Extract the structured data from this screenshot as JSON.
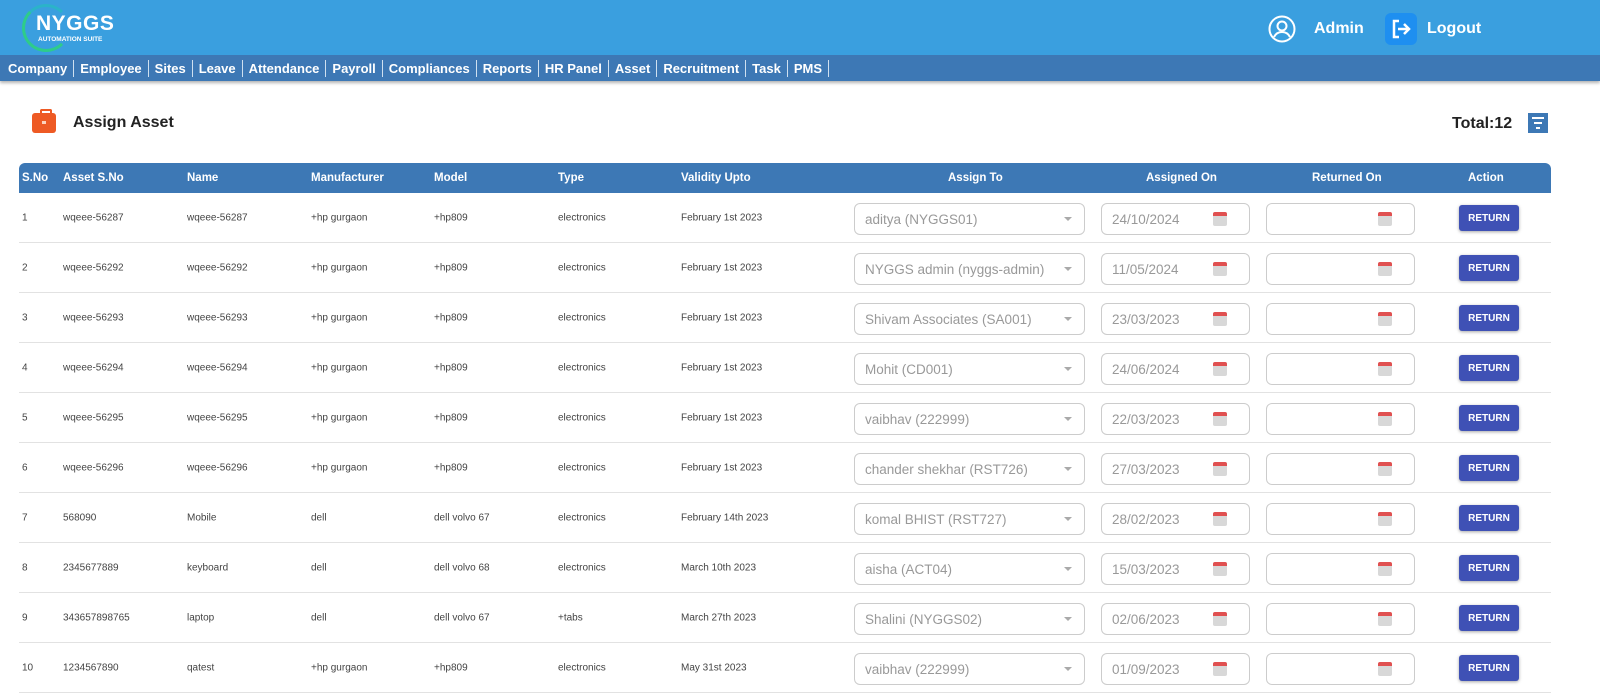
{
  "header": {
    "logo_title": "NYGGS",
    "logo_subtitle": "AUTOMATION SUITE",
    "user": "Admin",
    "logout": "Logout"
  },
  "nav": [
    "Company",
    "Employee",
    "Sites",
    "Leave",
    "Attendance",
    "Payroll",
    "Compliances",
    "Reports",
    "HR Panel",
    "Asset",
    "Recruitment",
    "Task",
    "PMS"
  ],
  "page": {
    "title": "Assign Asset",
    "total": "Total:12"
  },
  "columns": [
    "S.No",
    "Asset S.No",
    "Name",
    "Manufacturer",
    "Model",
    "Type",
    "Validity Upto",
    "Assign To",
    "Assigned On",
    "Returned On",
    "Action"
  ],
  "rows": [
    {
      "sno": "1",
      "asset": "wqeee-56287",
      "name": "wqeee-56287",
      "mfr": "+hp gurgaon",
      "model": "+hp809",
      "type": "electronics",
      "validity": "February 1st 2023",
      "assign": "aditya (NYGGS01)",
      "assigned_on": "24/10/2024",
      "returned_on": "",
      "action": "RETURN"
    },
    {
      "sno": "2",
      "asset": "wqeee-56292",
      "name": "wqeee-56292",
      "mfr": "+hp gurgaon",
      "model": "+hp809",
      "type": "electronics",
      "validity": "February 1st 2023",
      "assign": "NYGGS admin (nyggs-admin)",
      "assigned_on": "11/05/2024",
      "returned_on": "",
      "action": "RETURN"
    },
    {
      "sno": "3",
      "asset": "wqeee-56293",
      "name": "wqeee-56293",
      "mfr": "+hp gurgaon",
      "model": "+hp809",
      "type": "electronics",
      "validity": "February 1st 2023",
      "assign": "Shivam Associates (SA001)",
      "assigned_on": "23/03/2023",
      "returned_on": "",
      "action": "RETURN"
    },
    {
      "sno": "4",
      "asset": "wqeee-56294",
      "name": "wqeee-56294",
      "mfr": "+hp gurgaon",
      "model": "+hp809",
      "type": "electronics",
      "validity": "February 1st 2023",
      "assign": "Mohit (CD001)",
      "assigned_on": "24/06/2024",
      "returned_on": "",
      "action": "RETURN"
    },
    {
      "sno": "5",
      "asset": "wqeee-56295",
      "name": "wqeee-56295",
      "mfr": "+hp gurgaon",
      "model": "+hp809",
      "type": "electronics",
      "validity": "February 1st 2023",
      "assign": "vaibhav (222999)",
      "assigned_on": "22/03/2023",
      "returned_on": "",
      "action": "RETURN"
    },
    {
      "sno": "6",
      "asset": "wqeee-56296",
      "name": "wqeee-56296",
      "mfr": "+hp gurgaon",
      "model": "+hp809",
      "type": "electronics",
      "validity": "February 1st 2023",
      "assign": "chander  shekhar  (RST726)",
      "assigned_on": "27/03/2023",
      "returned_on": "",
      "action": "RETURN"
    },
    {
      "sno": "7",
      "asset": "568090",
      "name": "Mobile",
      "mfr": "dell",
      "model": "dell volvo 67",
      "type": "electronics",
      "validity": "February 14th 2023",
      "assign": "komal BHIST (RST727)",
      "assigned_on": "28/02/2023",
      "returned_on": "",
      "action": "RETURN"
    },
    {
      "sno": "8",
      "asset": "2345677889",
      "name": "keyboard",
      "mfr": "dell",
      "model": "dell volvo 68",
      "type": "electronics",
      "validity": "March 10th 2023",
      "assign": "aisha (ACT04)",
      "assigned_on": "15/03/2023",
      "returned_on": "",
      "action": "RETURN"
    },
    {
      "sno": "9",
      "asset": "343657898765",
      "name": "laptop",
      "mfr": "dell",
      "model": "dell volvo 67",
      "type": "+tabs",
      "validity": "March 27th 2023",
      "assign": "Shalini (NYGGS02)",
      "assigned_on": "02/06/2023",
      "returned_on": "",
      "action": "RETURN"
    },
    {
      "sno": "10",
      "asset": "1234567890",
      "name": "qatest",
      "mfr": "+hp gurgaon",
      "model": "+hp809",
      "type": "electronics",
      "validity": "May 31st 2023",
      "assign": "vaibhav (222999)",
      "assigned_on": "01/09/2023",
      "returned_on": "",
      "action": "RETURN"
    }
  ]
}
